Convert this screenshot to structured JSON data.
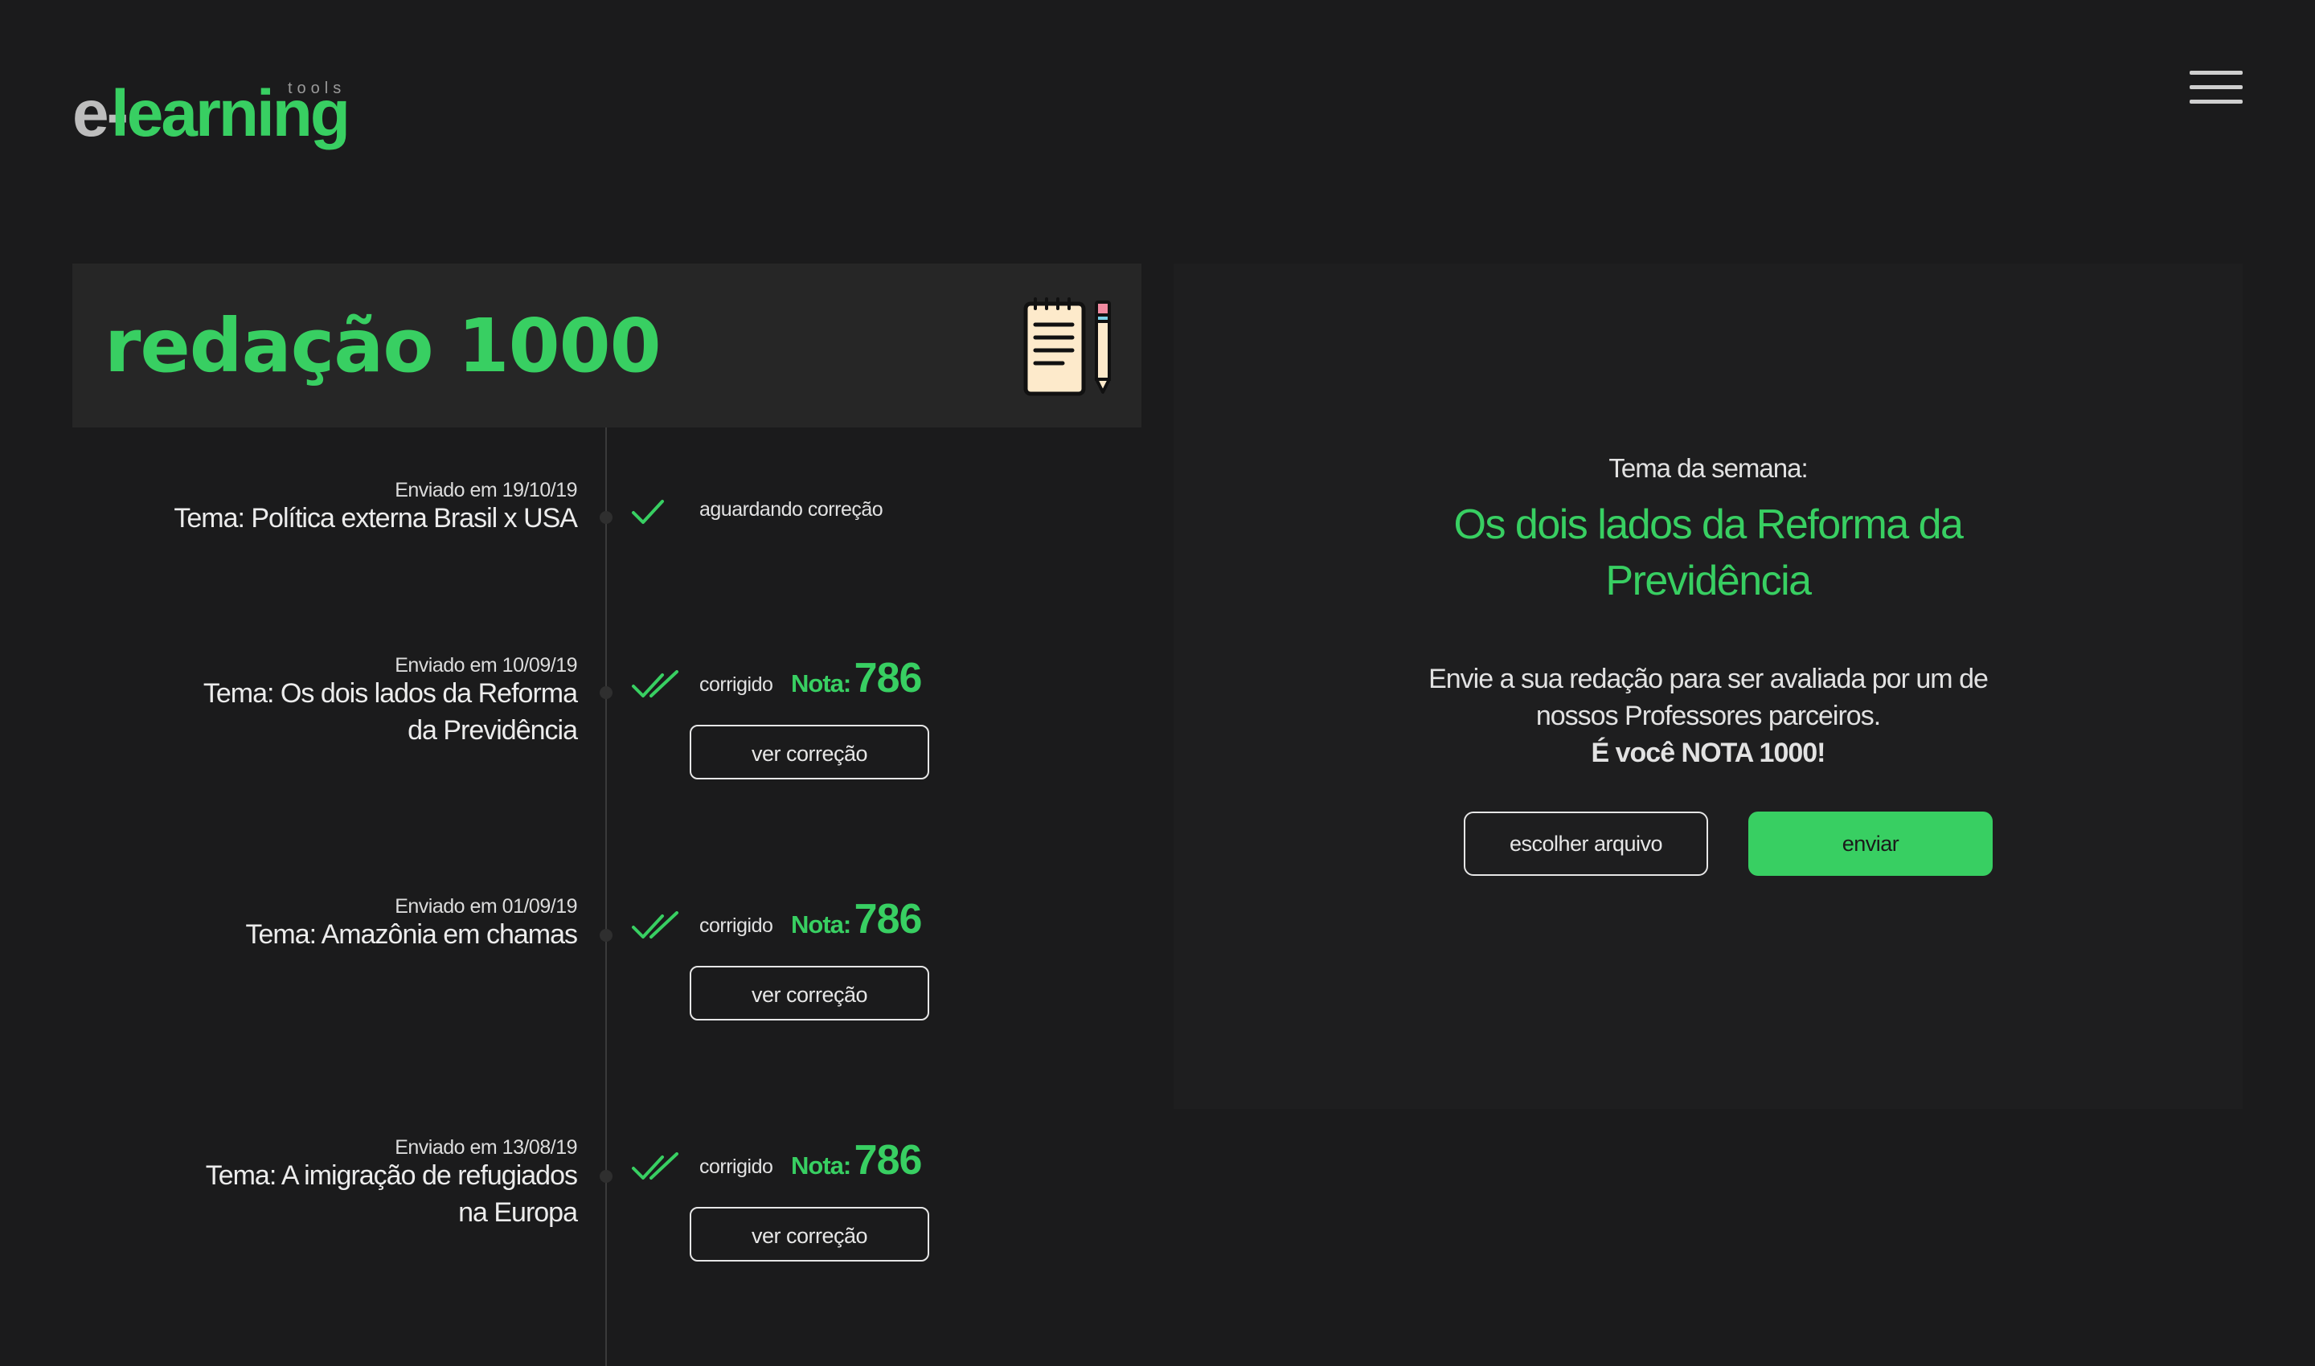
{
  "app": {
    "logo_prefix": "e-",
    "logo_main": "learning",
    "logo_suffix": "tools"
  },
  "header": {
    "title": "redação 1000",
    "menu_icon": "hamburger-menu-icon",
    "title_icon": "notepad-pencil-icon"
  },
  "colors": {
    "accent": "#38cf62",
    "background": "#1b1b1c",
    "panel": "#262626"
  },
  "timeline": {
    "items": [
      {
        "date": "Enviado em 19/10/19",
        "theme_lines": [
          "Tema: Política externa Brasil x USA"
        ],
        "status": "aguardando correção",
        "check_icon": "single-check-icon"
      },
      {
        "date": "Enviado em 10/09/19",
        "theme_lines": [
          "Tema: Os dois lados da Reforma",
          "da Previdência"
        ],
        "status": "corrigido",
        "nota_label": "Nota:",
        "nota_value": "786",
        "button_label": "ver correção",
        "check_icon": "double-check-icon"
      },
      {
        "date": "Enviado em 01/09/19",
        "theme_lines": [
          "Tema: Amazônia em chamas"
        ],
        "status": "corrigido",
        "nota_label": "Nota:",
        "nota_value": "786",
        "button_label": "ver correção",
        "check_icon": "double-check-icon"
      },
      {
        "date": "Enviado em 13/08/19",
        "theme_lines": [
          "Tema: A imigração de refugiados",
          "na Europa"
        ],
        "status": "corrigido",
        "nota_label": "Nota:",
        "nota_value": "786",
        "button_label": "ver correção",
        "check_icon": "double-check-icon"
      }
    ]
  },
  "upload": {
    "week_label": "Tema da semana:",
    "week_theme": "Os dois lados da Reforma da Previdência",
    "description": "Envie a sua redação para ser avaliada por um de nossos Professores parceiros.",
    "emphasis": "É você NOTA 1000!",
    "choose_button": "escolher arquivo",
    "send_button": "enviar"
  }
}
